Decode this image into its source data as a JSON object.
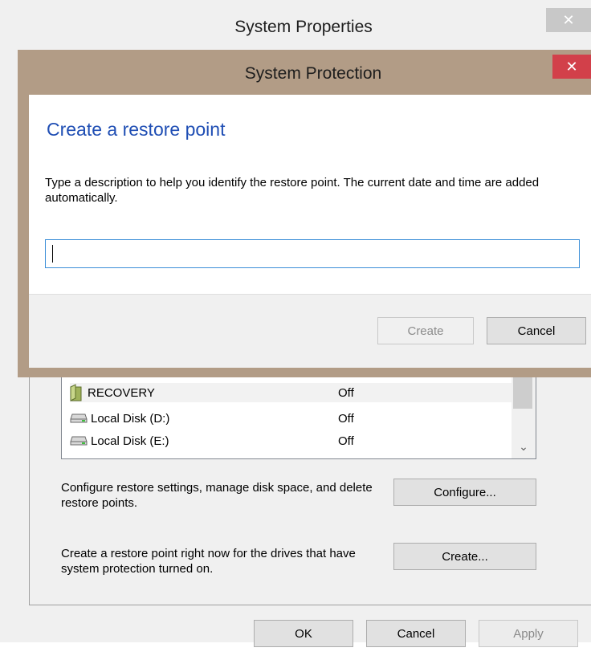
{
  "outer_window": {
    "title": "System Properties",
    "close_glyph": "✕",
    "drives": [
      {
        "name": "RECOVERY",
        "status": "Off",
        "icon": "folder-icon"
      },
      {
        "name": "Local Disk (D:)",
        "status": "Off",
        "icon": "drive-icon"
      },
      {
        "name": "Local Disk (E:)",
        "status": "Off",
        "icon": "drive-icon"
      }
    ],
    "configure_text": "Configure restore settings, manage disk space, and delete restore points.",
    "configure_button": "Configure...",
    "create_text": "Create a restore point right now for the drives that have system protection turned on.",
    "create_button": "Create...",
    "ok_button": "OK",
    "cancel_button": "Cancel",
    "apply_button": "Apply"
  },
  "dialog": {
    "title": "System Protection",
    "close_glyph": "✕",
    "heading": "Create a restore point",
    "description": "Type a description to help you identify the restore point. The current date and time are added automatically.",
    "input_value": "",
    "create_button": "Create",
    "cancel_button": "Cancel"
  },
  "colors": {
    "dialog_frame": "#b29c86",
    "close_red": "#d2404a",
    "heading_blue": "#1f4eb4",
    "input_focus": "#3c8fd8"
  }
}
